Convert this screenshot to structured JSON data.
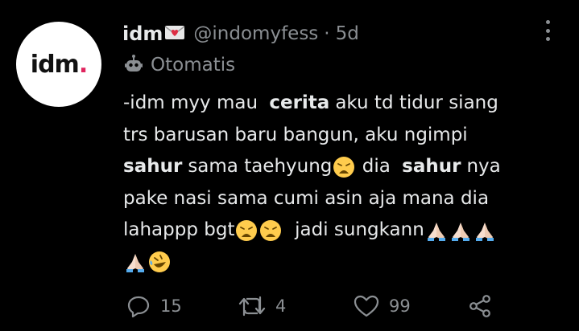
{
  "avatar": {
    "text": "idm",
    "dot": "."
  },
  "header": {
    "name": "idm",
    "handle": "@indomyfess",
    "separator": "·",
    "time": "5d"
  },
  "automated": {
    "label": "Otomatis"
  },
  "tweet_lines": [
    [
      "-idm myy mau ",
      "cerita",
      " aku td tidur siang"
    ],
    [
      "trs barusan baru bangun, aku ngimpi"
    ],
    [
      "sahur",
      " sama taehyung",
      "dia",
      "sahur",
      " nya"
    ],
    [
      "pake nasi sama cumi asin aja mana dia"
    ],
    [
      "lahappp bgt",
      "jadi sungkann"
    ]
  ],
  "text": {
    "l1a": "-idm myy mau",
    "l1b": "cerita",
    "l1c": "aku td tidur siang",
    "l2": "trs barusan baru bangun, aku ngimpi",
    "l3a": "sahur",
    "l3b": "sama taehyung",
    "l3c": "dia",
    "l3d": "sahur",
    "l3e": "nya",
    "l4": "pake nasi sama cumi asin aja mana dia",
    "l5a": "lahappp bgt",
    "l5b": "jadi sungkann"
  },
  "actions": {
    "replies": "15",
    "retweets": "4",
    "likes": "99"
  },
  "colors": {
    "background": "#000000",
    "text": "#e7e9ea",
    "secondary": "#8b8f93",
    "avatar_dot": "#e0245e"
  },
  "icons": [
    "envelope-heart-icon",
    "robot-icon",
    "weary-face-icon",
    "folded-hands-icon",
    "rolling-laughing-icon",
    "reply-icon",
    "retweet-icon",
    "like-icon",
    "share-icon",
    "more-icon"
  ]
}
